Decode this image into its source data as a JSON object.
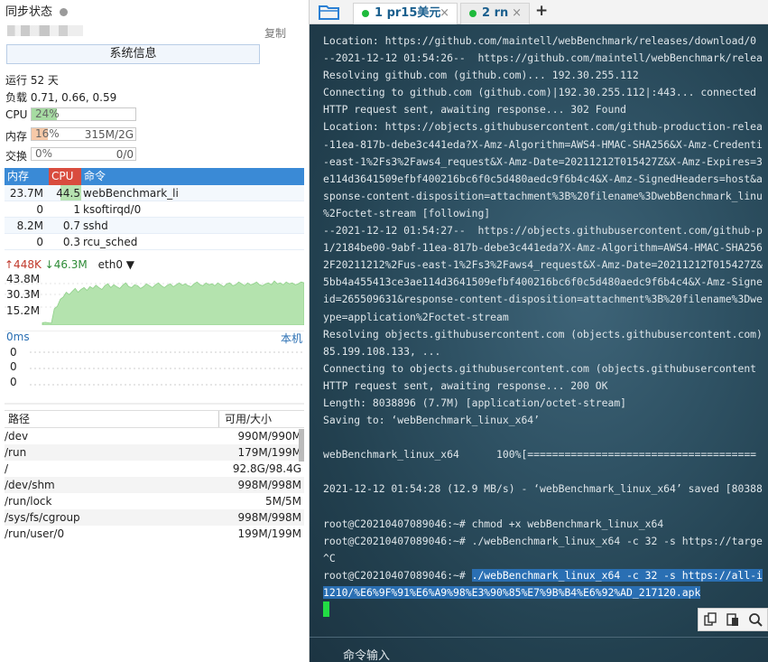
{
  "left": {
    "sync_label": "同步状态",
    "copy_label": "复制",
    "sysinfo_button": "系统信息",
    "uptime": "运行 52 天",
    "load": "负载 0.71, 0.66, 0.59",
    "cpu": {
      "label": "CPU",
      "pct": "24%",
      "level": 0.24,
      "color": "#a6dba2"
    },
    "mem": {
      "label": "内存",
      "pct": "16%",
      "level": 0.16,
      "value": "315M/2G",
      "color": "#f6c9a8"
    },
    "swap": {
      "label": "交换",
      "pct": "0%",
      "level": 0,
      "value": "0/0"
    },
    "proc_header": {
      "mem": "内存",
      "cpu": "CPU",
      "cmd": "命令"
    },
    "processes": [
      {
        "mem": "23.7M",
        "cpu": "44.5",
        "cmd": "webBenchmark_li"
      },
      {
        "mem": "0",
        "cpu": "1",
        "cmd": "ksoftirqd/0"
      },
      {
        "mem": "8.2M",
        "cpu": "0.7",
        "cmd": "sshd"
      },
      {
        "mem": "0",
        "cpu": "0.3",
        "cmd": "rcu_sched"
      }
    ],
    "net": {
      "up": "↑448K",
      "down": "↓46.3M",
      "iface": "eth0"
    },
    "net_ticks": [
      "43.8M",
      "30.3M",
      "15.2M"
    ],
    "ping": {
      "latency": "0ms",
      "target": "本机",
      "rows": [
        "0",
        "0",
        "0"
      ]
    },
    "disk_header": {
      "path": "路径",
      "usage": "可用/大小"
    },
    "disks": [
      {
        "path": "/dev",
        "usage": "990M/990M"
      },
      {
        "path": "/run",
        "usage": "179M/199M"
      },
      {
        "path": "/",
        "usage": "92.8G/98.4G"
      },
      {
        "path": "/dev/shm",
        "usage": "998M/998M"
      },
      {
        "path": "/run/lock",
        "usage": "5M/5M"
      },
      {
        "path": "/sys/fs/cgroup",
        "usage": "998M/998M"
      },
      {
        "path": "/run/user/0",
        "usage": "199M/199M"
      }
    ]
  },
  "tabs": [
    {
      "label": "1 pr15美元",
      "close": "×"
    },
    {
      "label": "2 rn",
      "close": "×"
    }
  ],
  "tab_add": "+",
  "terminal": {
    "lines": [
      "Location: https://github.com/maintell/webBenchmark/releases/download/0",
      "--2021-12-12 01:54:26--  https://github.com/maintell/webBenchmark/relea",
      "Resolving github.com (github.com)... 192.30.255.112",
      "Connecting to github.com (github.com)|192.30.255.112|:443... connected",
      "HTTP request sent, awaiting response... 302 Found",
      "Location: https://objects.githubusercontent.com/github-production-relea",
      "-11ea-817b-debe3c441eda?X-Amz-Algorithm=AWS4-HMAC-SHA256&X-Amz-Credenti",
      "-east-1%2Fs3%2Faws4_request&X-Amz-Date=20211212T015427Z&X-Amz-Expires=3",
      "e114d3641509efbf400216bc6f0c5d480aedc9f6b4c4&X-Amz-SignedHeaders=host&a",
      "sponse-content-disposition=attachment%3B%20filename%3DwebBenchmark_linu",
      "%2Foctet-stream [following]",
      "--2021-12-12 01:54:27--  https://objects.githubusercontent.com/github-p",
      "1/2184be00-9abf-11ea-817b-debe3c441eda?X-Amz-Algorithm=AWS4-HMAC-SHA256",
      "2F20211212%2Fus-east-1%2Fs3%2Faws4_request&X-Amz-Date=20211212T015427Z&",
      "5bb4a455413ce3ae114d3641509efbf400216bc6f0c5d480aedc9f6b4c4&X-Amz-Signe",
      "id=265509631&response-content-disposition=attachment%3B%20filename%3Dwe",
      "ype=application%2Foctet-stream",
      "Resolving objects.githubusercontent.com (objects.githubusercontent.com)",
      "85.199.108.133, ...",
      "Connecting to objects.githubusercontent.com (objects.githubusercontent",
      "HTTP request sent, awaiting response... 200 OK",
      "Length: 8038896 (7.7M) [application/octet-stream]",
      "Saving to: ‘webBenchmark_linux_x64’",
      "",
      "webBenchmark_linux_x64      100%[=====================================",
      "",
      "2021-12-12 01:54:28 (12.9 MB/s) - ‘webBenchmark_linux_x64’ saved [80388",
      "",
      "root@C20210407089046:~# chmod +x webBenchmark_linux_x64",
      "root@C20210407089046:~# ./webBenchmark_linux_x64 -c 32 -s https://targe",
      "^C"
    ],
    "prompt": "root@C20210407089046:~# ",
    "selected_1": "./webBenchmark_linux_x64 -c 32 -s https://all-i",
    "selected_2": "1210/%E6%9F%91%E6%A9%98%E3%90%85%E7%9B%B4%E6%92%AD_217120.apk"
  },
  "command_input_label": "命令输入",
  "net_series": [
    0.05,
    0.06,
    0.05,
    0.04,
    0.35,
    0.4,
    0.55,
    0.6,
    0.7,
    0.65,
    0.72,
    0.78,
    0.7,
    0.76,
    0.8,
    0.74,
    0.82,
    0.78,
    0.85,
    0.8,
    0.76,
    0.84,
    0.88,
    0.8,
    0.86,
    0.82,
    0.78,
    0.85,
    0.9,
    0.82,
    0.8,
    0.86,
    0.84,
    0.78,
    0.82,
    0.88,
    0.84,
    0.8,
    0.86,
    0.9,
    0.84,
    0.8,
    0.85,
    0.88,
    0.82,
    0.86,
    0.9,
    0.85,
    0.88,
    0.84,
    0.82,
    0.88,
    0.92,
    0.86,
    0.84,
    0.9,
    0.86,
    0.88,
    0.84,
    0.9,
    0.86,
    0.82,
    0.88,
    0.9,
    0.84,
    0.86,
    0.92,
    0.88,
    0.84,
    0.9,
    0.86,
    0.88,
    0.92,
    0.86,
    0.84,
    0.88,
    0.9,
    0.86,
    0.94,
    0.88,
    0.9,
    0.86,
    0.92,
    0.88,
    0.9,
    0.86,
    0.88,
    0.92,
    0.9
  ]
}
